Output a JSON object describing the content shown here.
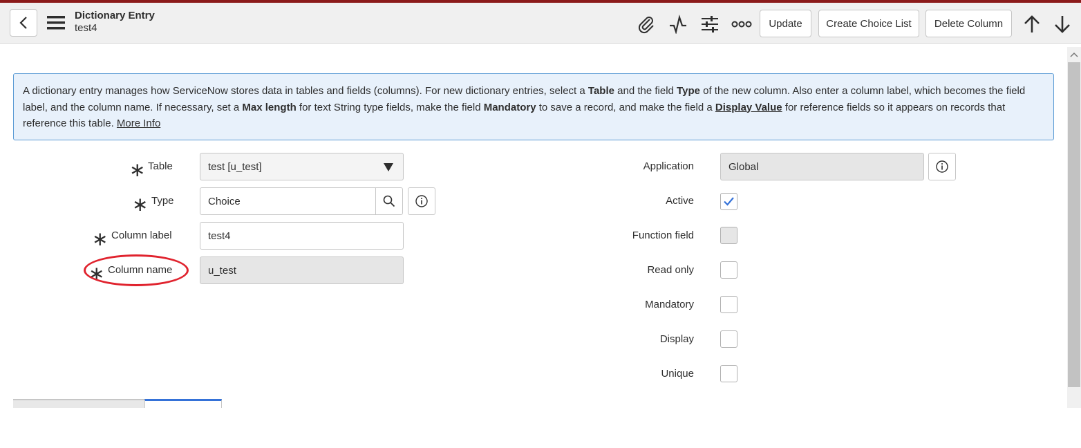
{
  "header": {
    "title": "Dictionary Entry",
    "subtitle": "test4",
    "buttons": {
      "update": "Update",
      "create_choice_list": "Create Choice List",
      "delete_column": "Delete Column"
    },
    "icons": [
      "back-chevron-icon",
      "menu-icon",
      "paperclip-icon",
      "activity-icon",
      "settings-sliders-icon",
      "more-options-icon",
      "arrow-up-icon",
      "arrow-down-icon"
    ]
  },
  "info": {
    "p1": "A dictionary entry manages how ServiceNow stores data in tables and fields (columns). For new dictionary entries, select a ",
    "b1": "Table",
    "p2": " and the field ",
    "b2": "Type",
    "p3": " of the new column. Also enter a column label, which becomes the field label, and the column name. If necessary, set a ",
    "b3": "Max length",
    "p4": " for text String type fields, make the field ",
    "b4": "Mandatory",
    "p5": " to save a record, and make the field a ",
    "b5": "Display Value",
    "p6": " for reference fields so it appears on records that reference this table. ",
    "more": "More Info"
  },
  "form": {
    "table": {
      "label": "Table",
      "value": "test [u_test]"
    },
    "type": {
      "label": "Type",
      "value": "Choice"
    },
    "column_label": {
      "label": "Column label",
      "value": "test4"
    },
    "column_name": {
      "label": "Column name",
      "value": "u_test"
    },
    "application": {
      "label": "Application",
      "value": "Global"
    },
    "active": {
      "label": "Active",
      "checked": true
    },
    "function_field": {
      "label": "Function field",
      "checked": false
    },
    "read_only": {
      "label": "Read only",
      "checked": false
    },
    "mandatory": {
      "label": "Mandatory",
      "checked": false
    },
    "display": {
      "label": "Display",
      "checked": false
    },
    "unique": {
      "label": "Unique",
      "checked": false
    }
  },
  "colors": {
    "accent": "#3572d8",
    "top_bar": "#8b1a1a",
    "highlight": "#e0232e",
    "info_bg": "#e8f1fb",
    "info_border": "#5b9bd5"
  }
}
